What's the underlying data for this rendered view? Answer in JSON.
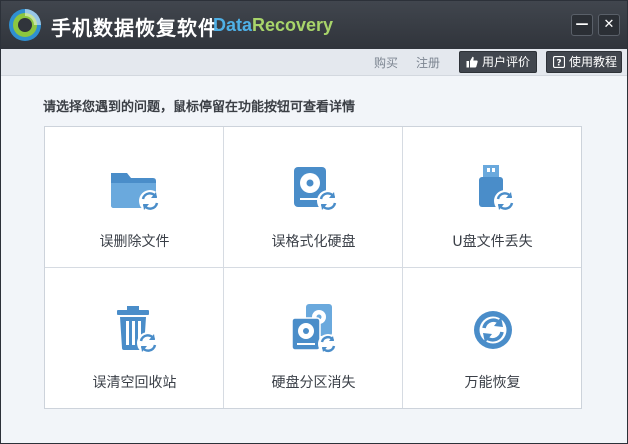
{
  "window": {
    "title": "手机数据恢复软件",
    "brand_part1": "Data",
    "brand_part2": "Recovery",
    "minimize_glyph": "—",
    "close_glyph": "✕"
  },
  "toolbar": {
    "buy": "购买",
    "register": "注册",
    "user_review": "用户评价",
    "tutorial": "使用教程"
  },
  "prompt": "请选择您遇到的问题，鼠标停留在功能按钮可查看详情",
  "options": [
    {
      "label": "误删除文件",
      "icon": "folder-recover-icon"
    },
    {
      "label": "误格式化硬盘",
      "icon": "harddisk-recover-icon"
    },
    {
      "label": "U盘文件丢失",
      "icon": "usb-drive-recover-icon"
    },
    {
      "label": "误清空回收站",
      "icon": "recycle-bin-recover-icon"
    },
    {
      "label": "硬盘分区消失",
      "icon": "partition-recover-icon"
    },
    {
      "label": "万能恢复",
      "icon": "universal-recover-icon"
    }
  ],
  "colors": {
    "icon_blue": "#4a8dc9",
    "icon_light": "#6aa9dd",
    "titlebar": "#383c43",
    "brand_blue": "#4fb0e6",
    "brand_green": "#a8d46a"
  }
}
